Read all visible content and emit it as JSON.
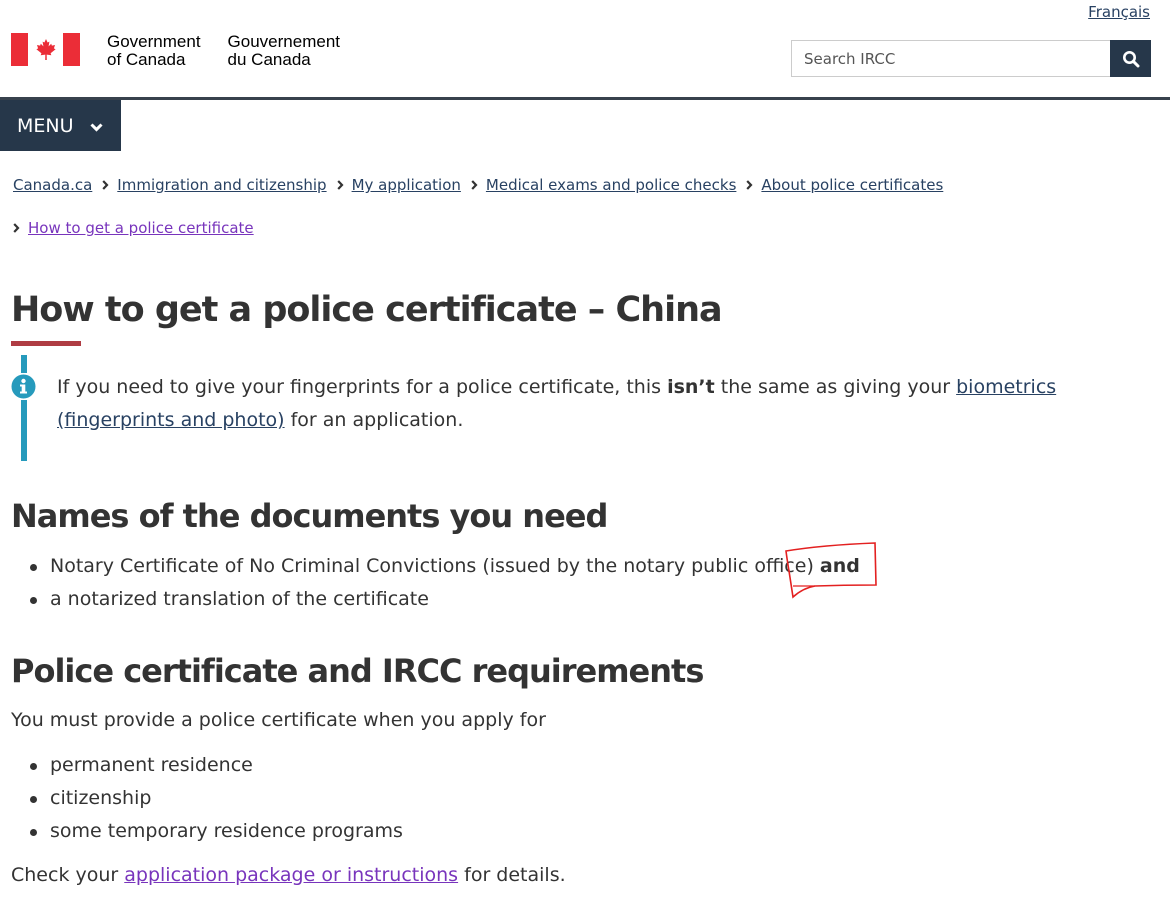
{
  "header": {
    "language_toggle": "Français",
    "signature": {
      "en_line1": "Government",
      "en_line2": "of Canada",
      "fr_line1": "Gouvernement",
      "fr_line2": "du Canada",
      "flag_icon": "canada-flag-icon"
    },
    "search": {
      "placeholder": "Search IRCC",
      "value": "",
      "button_icon": "search-icon"
    },
    "menu_label": "MENU",
    "colors": {
      "nav": "#26374a",
      "flag_red": "#eb2d37"
    }
  },
  "breadcrumb": [
    {
      "label": "Canada.ca"
    },
    {
      "label": "Immigration and citizenship"
    },
    {
      "label": "My application"
    },
    {
      "label": "Medical exams and police checks"
    },
    {
      "label": "About police certificates"
    },
    {
      "label": "How to get a police certificate"
    }
  ],
  "main": {
    "title": "How to get a police certificate – China",
    "title_rule_color": "#af3c43",
    "info_alert": {
      "icon": "info-icon",
      "color": "#269abc",
      "text_before": "If you need to give your fingerprints for a police certificate, this ",
      "text_bold": "isn’t",
      "text_middle": " the same as giving your ",
      "link_text": "biometrics (fingerprints and photo)",
      "text_after": " for an application."
    },
    "documents_section": {
      "heading": "Names of the documents you need",
      "items": [
        {
          "text": "Notary Certificate of No Criminal Convictions (issued by the notary public office) ",
          "bold": "and"
        },
        {
          "text": "a notarized translation of the certificate",
          "bold": ""
        }
      ]
    },
    "requirements_section": {
      "heading": "Police certificate and IRCC requirements",
      "intro": "You must provide a police certificate when you apply for",
      "items": [
        "permanent residence",
        "citizenship",
        "some temporary residence programs"
      ],
      "check_before": "Check your ",
      "check_link": "application package or instructions",
      "check_after": " for details."
    },
    "annotation": {
      "type": "hand-drawn-box",
      "color": "#e32020",
      "target": "and"
    }
  }
}
